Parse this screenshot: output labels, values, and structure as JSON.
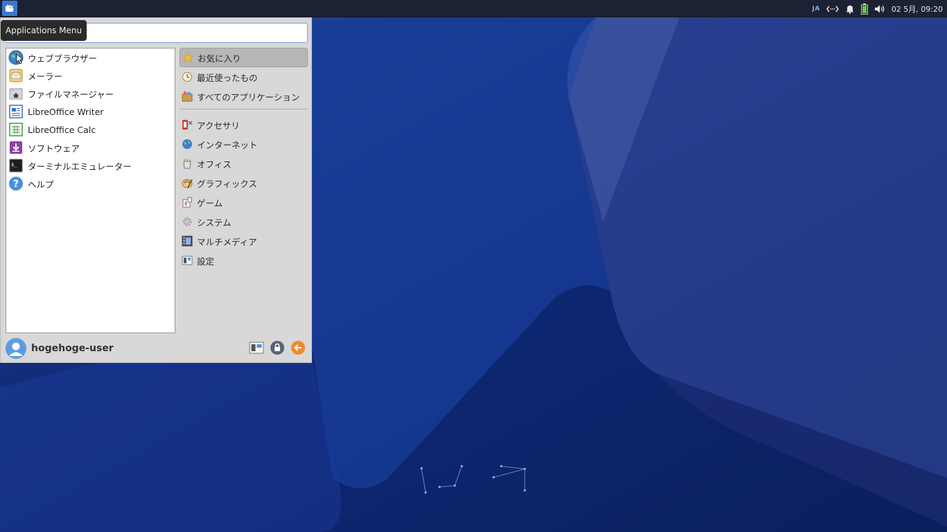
{
  "tooltip": "Applications Menu",
  "panel": {
    "lang": "JA",
    "clock": "02 5月, 09:20"
  },
  "search": {
    "value": "",
    "placeholder": ""
  },
  "favorites": [
    {
      "label": "ウェブブラウザー",
      "icon": "web-browser-icon"
    },
    {
      "label": "メーラー",
      "icon": "mail-icon"
    },
    {
      "label": "ファイルマネージャー",
      "icon": "file-manager-icon"
    },
    {
      "label": "LibreOffice Writer",
      "icon": "writer-icon"
    },
    {
      "label": "LibreOffice Calc",
      "icon": "calc-icon"
    },
    {
      "label": "ソフトウェア",
      "icon": "software-icon"
    },
    {
      "label": "ターミナルエミュレーター",
      "icon": "terminal-icon"
    },
    {
      "label": "ヘルプ",
      "icon": "help-icon"
    }
  ],
  "categories": {
    "top": [
      {
        "label": "お気に入り",
        "icon": "star-icon"
      },
      {
        "label": "最近使ったもの",
        "icon": "recent-icon"
      },
      {
        "label": "すべてのアプリケーション",
        "icon": "all-apps-icon"
      }
    ],
    "main": [
      {
        "label": "アクセサリ",
        "icon": "accessories-icon"
      },
      {
        "label": "インターネット",
        "icon": "internet-icon"
      },
      {
        "label": "オフィス",
        "icon": "office-icon"
      },
      {
        "label": "グラフィックス",
        "icon": "graphics-icon"
      },
      {
        "label": "ゲーム",
        "icon": "games-icon"
      },
      {
        "label": "システム",
        "icon": "system-icon"
      },
      {
        "label": "マルチメディア",
        "icon": "multimedia-icon"
      },
      {
        "label": "設定",
        "icon": "settings-icon"
      }
    ]
  },
  "user": {
    "name": "hogehoge-user"
  },
  "colors": {
    "panel": "#1c2233",
    "menu": "#d8d8d8",
    "accent": "#3a78d4"
  }
}
